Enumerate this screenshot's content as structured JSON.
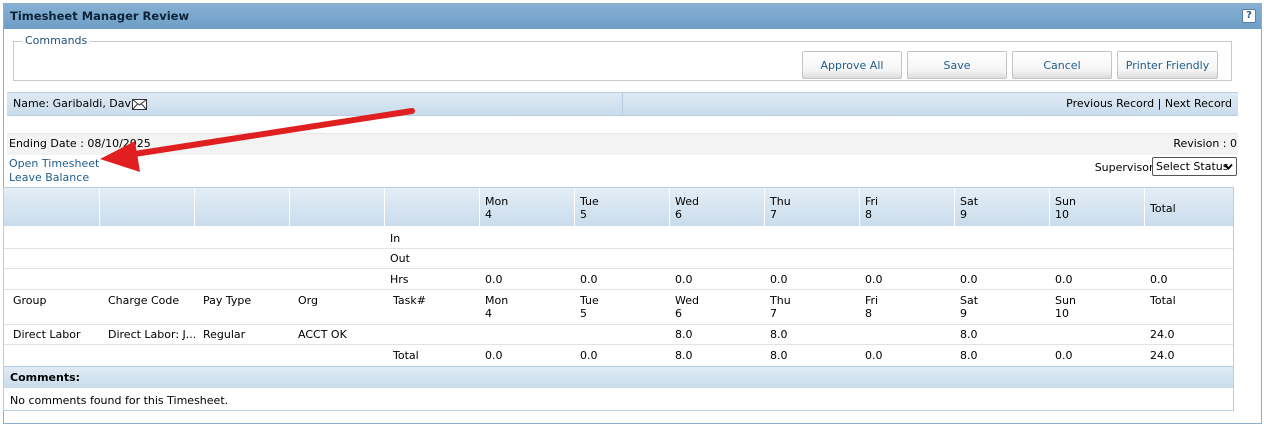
{
  "window": {
    "title": "Timesheet Manager Review",
    "help": "?"
  },
  "commands": {
    "legend": "Commands",
    "approve_all": "Approve All",
    "save": "Save",
    "cancel": "Cancel",
    "printer_friendly": "Printer Friendly"
  },
  "record": {
    "name": "Name: Garibaldi, David",
    "prev_next": "Previous Record | Next Record",
    "ending_date": "Ending Date : 08/10/2025",
    "revision": "Revision : 0",
    "open_timesheet": "Open Timesheet",
    "leave_balance": "Leave Balance",
    "supervisor_label": "Supervisor:",
    "supervisor_value": "Select Status"
  },
  "days": [
    {
      "name": "Mon",
      "num": "4"
    },
    {
      "name": "Tue",
      "num": "5"
    },
    {
      "name": "Wed",
      "num": "6"
    },
    {
      "name": "Thu",
      "num": "7"
    },
    {
      "name": "Fri",
      "num": "8"
    },
    {
      "name": "Sat",
      "num": "9"
    },
    {
      "name": "Sun",
      "num": "10"
    }
  ],
  "total_label": "Total",
  "time_rows": {
    "in": "In",
    "out": "Out",
    "hrs": "Hrs",
    "hrs_values": [
      "0.0",
      "0.0",
      "0.0",
      "0.0",
      "0.0",
      "0.0",
      "0.0",
      "0.0"
    ]
  },
  "columns": {
    "group": "Group",
    "charge_code": "Charge Code",
    "pay_type": "Pay Type",
    "org": "Org",
    "task": "Task#"
  },
  "entry": {
    "group": "Direct Labor",
    "charge_code": "Direct Labor: J...",
    "pay_type": "Regular",
    "org": "ACCT OK",
    "values": [
      "",
      "",
      "8.0",
      "8.0",
      "",
      "8.0",
      "",
      "24.0"
    ]
  },
  "totals": {
    "label": "Total",
    "values": [
      "0.0",
      "0.0",
      "8.0",
      "8.0",
      "0.0",
      "8.0",
      "0.0",
      "24.0"
    ]
  },
  "comments": {
    "header": "Comments:",
    "text": "No comments found for this Timesheet."
  },
  "colors": {
    "title_bar": "#7ba8cf",
    "link": "#1f5d8a",
    "arrow": "#e02020"
  }
}
